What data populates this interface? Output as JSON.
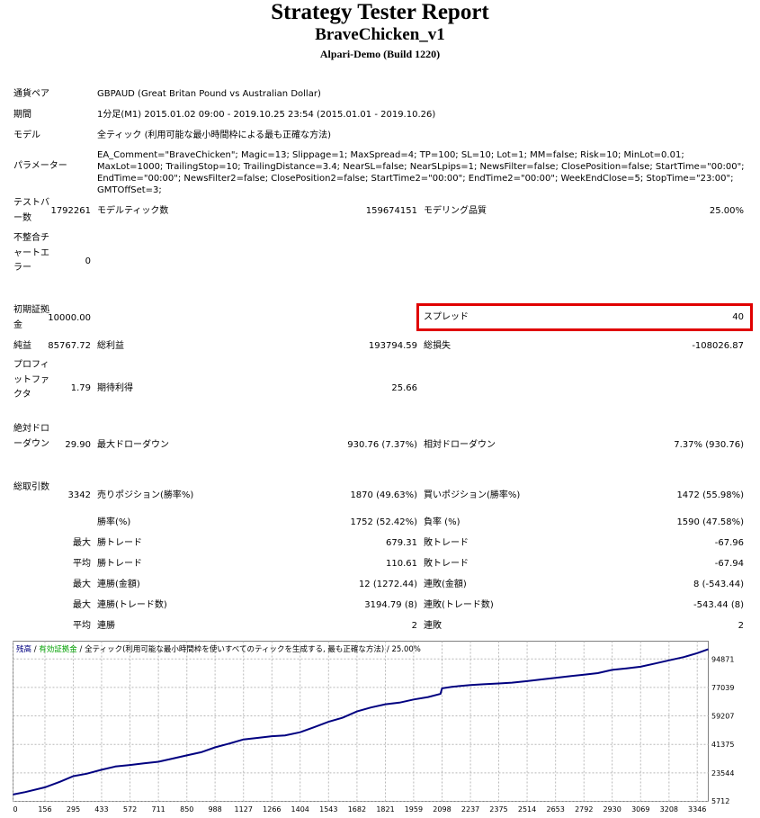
{
  "header": {
    "title": "Strategy Tester Report",
    "ea_name": "BraveChicken_v1",
    "server": "Alpari-Demo (Build 1220)"
  },
  "info": {
    "pair_label": "通貨ペア",
    "pair_value": "GBPAUD (Great Britan Pound vs Australian Dollar)",
    "period_label": "期間",
    "period_value": "1分足(M1) 2015.01.02 09:00 - 2019.10.25 23:54 (2015.01.01 - 2019.10.26)",
    "model_label": "モデル",
    "model_value": "全ティック (利用可能な最小時間枠による最も正確な方法)",
    "params_label": "パラメーター",
    "params_value": "EA_Comment=\"BraveChicken\"; Magic=13; Slippage=1; MaxSpread=4; TP=100; SL=10; Lot=1; MM=false; Risk=10; MinLot=0.01; MaxLot=1000; TrailingStop=10; TrailingDistance=3.4; NearSL=false; NearSLpips=1; NewsFilter=false; ClosePosition=false; StartTime=\"00:00\"; EndTime=\"00:00\"; NewsFilter2=false; ClosePosition2=false; StartTime2=\"00:00\"; EndTime2=\"00:00\"; WeekEndClose=5; StopTime=\"23:00\"; GMTOffSet=3;"
  },
  "stats": {
    "bars_label": "テストバー数",
    "bars_value": "1792261",
    "ticks_label": "モデルティック数",
    "ticks_value": "159674151",
    "quality_label": "モデリング品質",
    "quality_value": "25.00%",
    "mismatch_label": "不整合チャートエラー",
    "mismatch_value": "0",
    "deposit_label": "初期証拠金",
    "deposit_value": "10000.00",
    "spread_label": "スプレッド",
    "spread_value": "40",
    "net_label": "純益",
    "net_value": "85767.72",
    "gross_profit_label": "総利益",
    "gross_profit_value": "193794.59",
    "gross_loss_label": "総損失",
    "gross_loss_value": "-108026.87",
    "pf_label": "プロフィットファクタ",
    "pf_value": "1.79",
    "expected_label": "期待利得",
    "expected_value": "25.66",
    "abs_dd_label": "絶対ドローダウン",
    "abs_dd_value": "29.90",
    "max_dd_label": "最大ドローダウン",
    "max_dd_value": "930.76 (7.37%)",
    "rel_dd_label": "相対ドローダウン",
    "rel_dd_value": "7.37% (930.76)",
    "trades_label": "総取引数",
    "trades_value": "3342",
    "short_label": "売りポジション(勝率%)",
    "short_value": "1870 (49.63%)",
    "long_label": "買いポジション(勝率%)",
    "long_value": "1472 (55.98%)",
    "winrate_label": "勝率(%)",
    "winrate_value": "1752 (52.42%)",
    "lossrate_label": "負率 (%)",
    "lossrate_value": "1590 (47.58%)",
    "max_prefix": "最大",
    "avg_prefix": "平均",
    "largest_win_label": "勝トレード",
    "largest_win_value": "679.31",
    "largest_loss_label": "敗トレード",
    "largest_loss_value": "-67.96",
    "avg_win_label": "勝トレード",
    "avg_win_value": "110.61",
    "avg_loss_label": "敗トレード",
    "avg_loss_value": "-67.94",
    "max_consec_win_label": "連勝(金額)",
    "max_consec_win_value": "12 (1272.44)",
    "max_consec_loss_label": "連敗(金額)",
    "max_consec_loss_value": "8 (-543.44)",
    "max_consec_profit_label": "連勝(トレード数)",
    "max_consec_profit_value": "3194.79 (8)",
    "max_consec_lossamt_label": "連敗(トレード数)",
    "max_consec_lossamt_value": "-543.44 (8)",
    "avg_consec_win_label": "連勝",
    "avg_consec_win_value": "2",
    "avg_consec_loss_label": "連敗",
    "avg_consec_loss_value": "2"
  },
  "chart_data": {
    "type": "line",
    "legend": {
      "balance": "残高",
      "sep1": " / ",
      "margin": "有効証拠金",
      "sep2": " / ",
      "model": "全ティック(利用可能な最小時間枠を使いすべてのティックを生成する, 最も正確な方法)",
      "sep3": " / ",
      "quality": "25.00%"
    },
    "colors": {
      "balance": "#000080",
      "margin": "#00a000",
      "grid": "#b8b8b8"
    },
    "ylim": [
      5712,
      106000
    ],
    "yticks": [
      5712,
      23544,
      41375,
      59207,
      77039,
      94871
    ],
    "xlim": [
      0,
      3400
    ],
    "xticks": [
      0,
      156,
      295,
      433,
      572,
      711,
      850,
      988,
      1127,
      1266,
      1404,
      1543,
      1682,
      1821,
      1959,
      2098,
      2237,
      2375,
      2514,
      2653,
      2792,
      2930,
      3069,
      3208,
      3346
    ],
    "x": [
      0,
      60,
      156,
      230,
      295,
      360,
      433,
      500,
      572,
      640,
      711,
      780,
      850,
      920,
      988,
      1060,
      1127,
      1200,
      1266,
      1330,
      1404,
      1470,
      1543,
      1610,
      1682,
      1750,
      1821,
      1890,
      1959,
      2030,
      2090,
      2098,
      2150,
      2237,
      2300,
      2375,
      2440,
      2514,
      2580,
      2653,
      2720,
      2792,
      2860,
      2930,
      3000,
      3069,
      3140,
      3208,
      3280,
      3346,
      3400
    ],
    "values": [
      10000,
      11500,
      14500,
      18000,
      21500,
      23000,
      25500,
      27500,
      28500,
      29500,
      30500,
      32500,
      34500,
      36500,
      39500,
      42000,
      44500,
      45500,
      46500,
      47000,
      49000,
      52000,
      55500,
      58000,
      62000,
      64500,
      66500,
      67500,
      69500,
      71000,
      73000,
      76500,
      77500,
      78500,
      79000,
      79500,
      80000,
      81000,
      82000,
      83000,
      84000,
      85000,
      86000,
      88000,
      89000,
      90000,
      92000,
      94000,
      96000,
      98500,
      101000
    ]
  }
}
